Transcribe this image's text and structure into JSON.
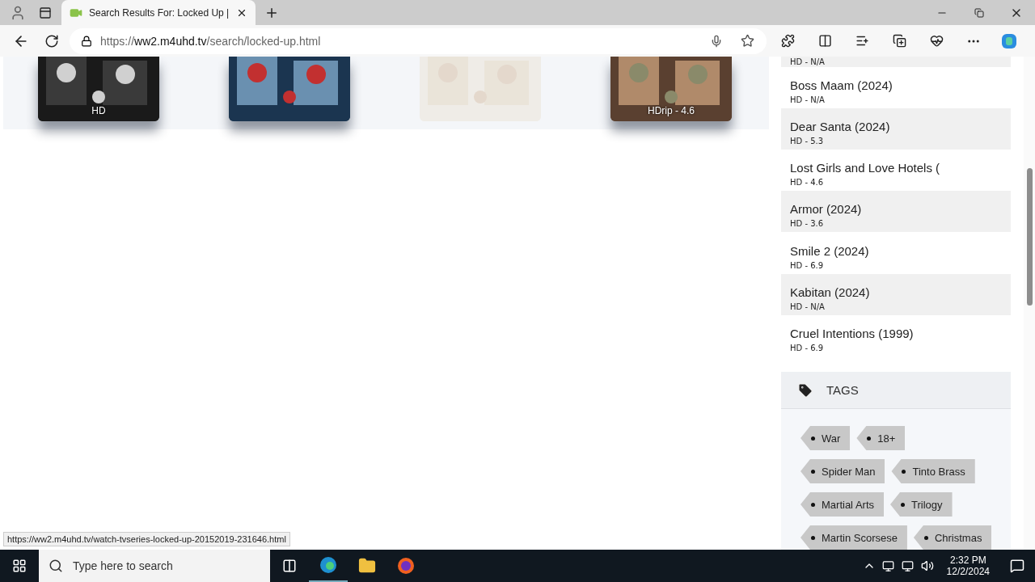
{
  "browser": {
    "tab": {
      "title": "Search Results For: Locked Up |",
      "selected": true
    },
    "url": {
      "scheme": "https://",
      "host": "ww2.m4uhd.tv",
      "path": "/search/locked-up.html"
    },
    "status_url": "https://ww2.m4uhd.tv/watch-tvseries-locked-up-20152019-231646.html"
  },
  "posters": [
    {
      "badge": "HD",
      "faded": false
    },
    {
      "faded": false
    },
    {
      "faded": true
    },
    {
      "badge": "HDrip - 4.6",
      "faded": false
    }
  ],
  "sidebar": {
    "movies": [
      {
        "quality": "HD - N/A"
      },
      {
        "title": "Boss Maam (2024)",
        "quality": "HD - N/A"
      },
      {
        "title": "Dear Santa (2024)",
        "quality": "HD - 5.3"
      },
      {
        "title": "Lost Girls and Love Hotels (",
        "quality": "HD - 4.6"
      },
      {
        "title": "Armor (2024)",
        "quality": "HD - 3.6"
      },
      {
        "title": "Smile 2 (2024)",
        "quality": "HD - 6.9"
      },
      {
        "title": "Kabitan (2024)",
        "quality": "HD - N/A"
      },
      {
        "title": "Cruel Intentions (1999)",
        "quality": "HD - 6.9"
      }
    ],
    "tags_title": "TAGS",
    "tags": [
      "War",
      "18+",
      "Spider Man",
      "Tinto Brass",
      "Martial Arts",
      "Trilogy",
      "Martin Scorsese",
      "Christmas"
    ]
  },
  "taskbar": {
    "search_placeholder": "Type here to search",
    "time": "2:32 PM",
    "date": "12/2/2024"
  }
}
